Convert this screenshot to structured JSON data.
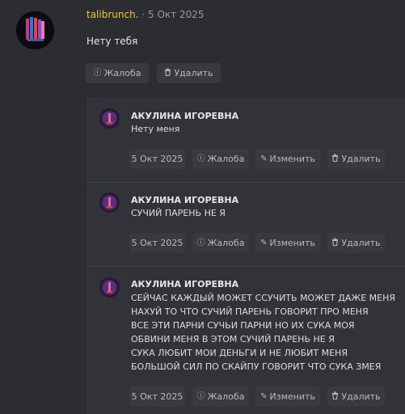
{
  "top_comment": {
    "username": "talibrunch.",
    "separator": "·",
    "date": "5 Окт 2025",
    "text": "Нету тебя",
    "report_label": "Жалоба",
    "delete_label": "Удалить"
  },
  "replies": [
    {
      "author": "АКУЛИНА ИГОРЕВНА",
      "lines": [
        "Нету меня"
      ],
      "date": "5 Окт 2025",
      "report_label": "Жалоба",
      "edit_label": "Изменить",
      "delete_label": "Удалить"
    },
    {
      "author": "АКУЛИНА ИГОРЕВНА",
      "lines": [
        "СУЧИЙ ПАРЕНЬ НЕ Я"
      ],
      "date": "5 Окт 2025",
      "report_label": "Жалоба",
      "edit_label": "Изменить",
      "delete_label": "Удалить"
    },
    {
      "author": "АКУЛИНА ИГОРЕВНА",
      "lines": [
        "СЕЙЧАС КАЖДЫЙ МОЖЕТ ССУЧИТЬ МОЖЕТ ДАЖЕ МЕНЯ",
        "НАХУЙ ТО ЧТО СУЧИЙ ПАРЕНЬ ГОВОРИТ ПРО МЕНЯ",
        "ВСЕ ЭТИ ПАРНИ СУЧЬИ ПАРНИ НО ИХ СУКА МОЯ",
        "ОБВИНИ МЕНЯ В ЭТОМ СУЧИЙ ПАРЕНЬ НЕ Я",
        "СУКА ЛЮБИТ МОИ ДЕНЬГИ И НЕ ЛЮБИТ МЕНЯ",
        "БОЛЬШОЙ СИЛ ПО СКАЙПУ ГОВОРИТ ЧТО СУКА ЗМЕЯ"
      ],
      "date": "5 Окт 2025",
      "report_label": "Жалоба",
      "edit_label": "Изменить",
      "delete_label": "Удалить"
    }
  ],
  "icons": {
    "report": "info-circle-icon",
    "edit": "pencil-icon",
    "delete": "trash-icon"
  }
}
